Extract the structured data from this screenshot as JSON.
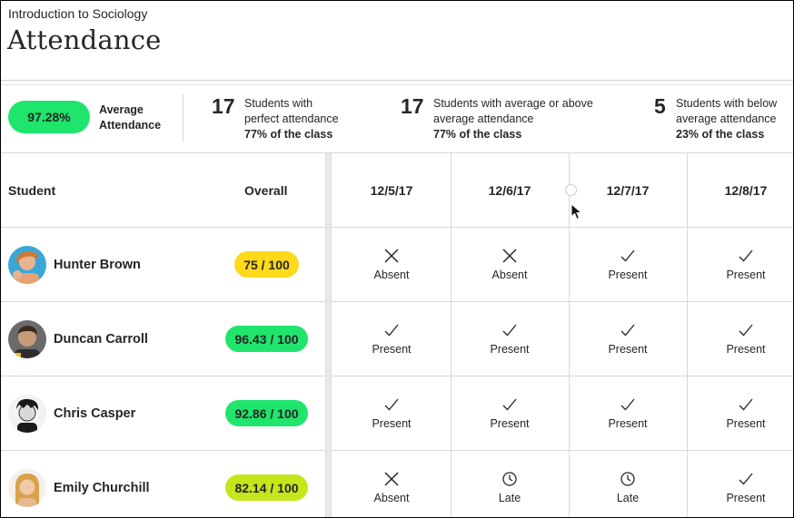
{
  "header": {
    "course": "Introduction to Sociology",
    "title": "Attendance"
  },
  "summary": {
    "average": {
      "value": "97.28%",
      "label": "Average Attendance"
    },
    "stats": [
      {
        "count": "17",
        "line1": "Students with",
        "line2": "perfect attendance",
        "pct": "77% of the class"
      },
      {
        "count": "17",
        "line1": "Students with average or above",
        "line2": "average attendance",
        "pct": "77% of the class"
      },
      {
        "count": "5",
        "line1": "Students with below",
        "line2": "average attendance",
        "pct": "23% of the class"
      }
    ],
    "colors": {
      "accent": "#1fe56c"
    }
  },
  "table": {
    "headers": {
      "student": "Student",
      "overall": "Overall"
    },
    "dates": [
      "12/5/17",
      "12/6/17",
      "12/7/17",
      "12/8/17"
    ],
    "rows": [
      {
        "name": "Hunter Brown",
        "grade": "75 / 100",
        "grade_color": "#ffd91a",
        "cells": [
          {
            "status": "Absent",
            "icon": "close-icon"
          },
          {
            "status": "Absent",
            "icon": "close-icon"
          },
          {
            "status": "Present",
            "icon": "check-icon"
          },
          {
            "status": "Present",
            "icon": "check-icon"
          }
        ]
      },
      {
        "name": "Duncan Carroll",
        "grade": "96.43 / 100",
        "grade_color": "#1fe56c",
        "cells": [
          {
            "status": "Present",
            "icon": "check-icon"
          },
          {
            "status": "Present",
            "icon": "check-icon"
          },
          {
            "status": "Present",
            "icon": "check-icon"
          },
          {
            "status": "Present",
            "icon": "check-icon"
          }
        ]
      },
      {
        "name": "Chris Casper",
        "grade": "92.86 / 100",
        "grade_color": "#1fe56c",
        "cells": [
          {
            "status": "Present",
            "icon": "check-icon"
          },
          {
            "status": "Present",
            "icon": "check-icon"
          },
          {
            "status": "Present",
            "icon": "check-icon"
          },
          {
            "status": "Present",
            "icon": "check-icon"
          }
        ]
      },
      {
        "name": "Emily Churchill",
        "grade": "82.14 / 100",
        "grade_color": "#c5e61a",
        "cells": [
          {
            "status": "Absent",
            "icon": "close-icon"
          },
          {
            "status": "Late",
            "icon": "clock-icon"
          },
          {
            "status": "Late",
            "icon": "clock-icon"
          },
          {
            "status": "Present",
            "icon": "check-icon"
          }
        ]
      }
    ]
  }
}
